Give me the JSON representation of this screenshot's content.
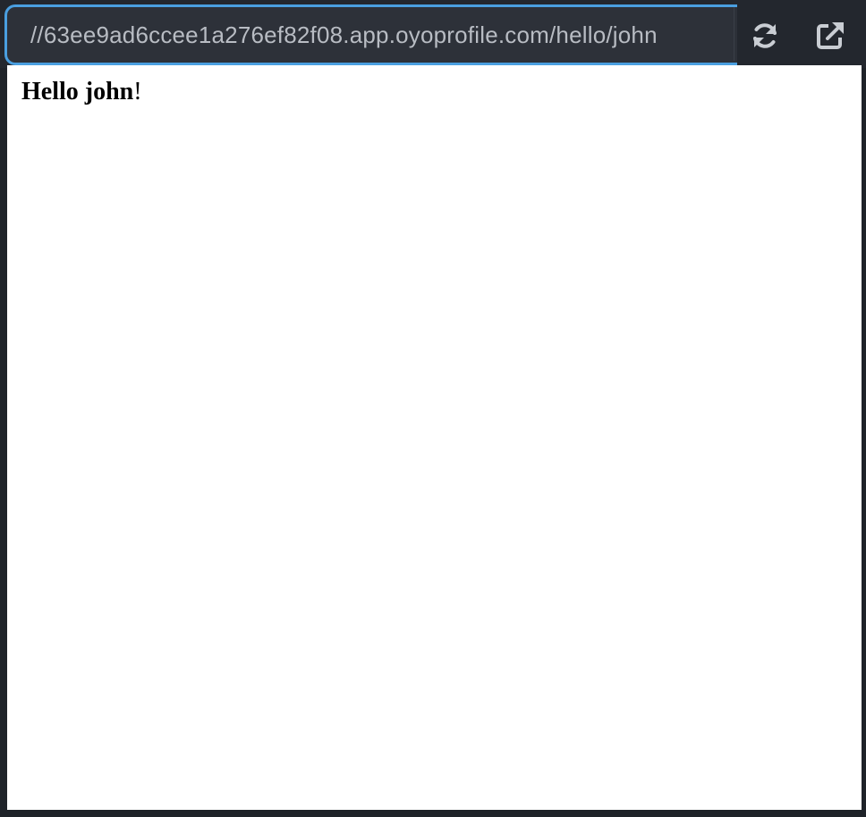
{
  "browser": {
    "url": "//63ee9ad6ccee1a276ef82f08.app.oyoprofile.com/hello/john",
    "refresh_icon": "refresh-icon",
    "open_external_icon": "external-link-icon",
    "accent_color": "#4a9fe0"
  },
  "page": {
    "greeting_prefix": "Hello john",
    "greeting_suffix": "!"
  }
}
